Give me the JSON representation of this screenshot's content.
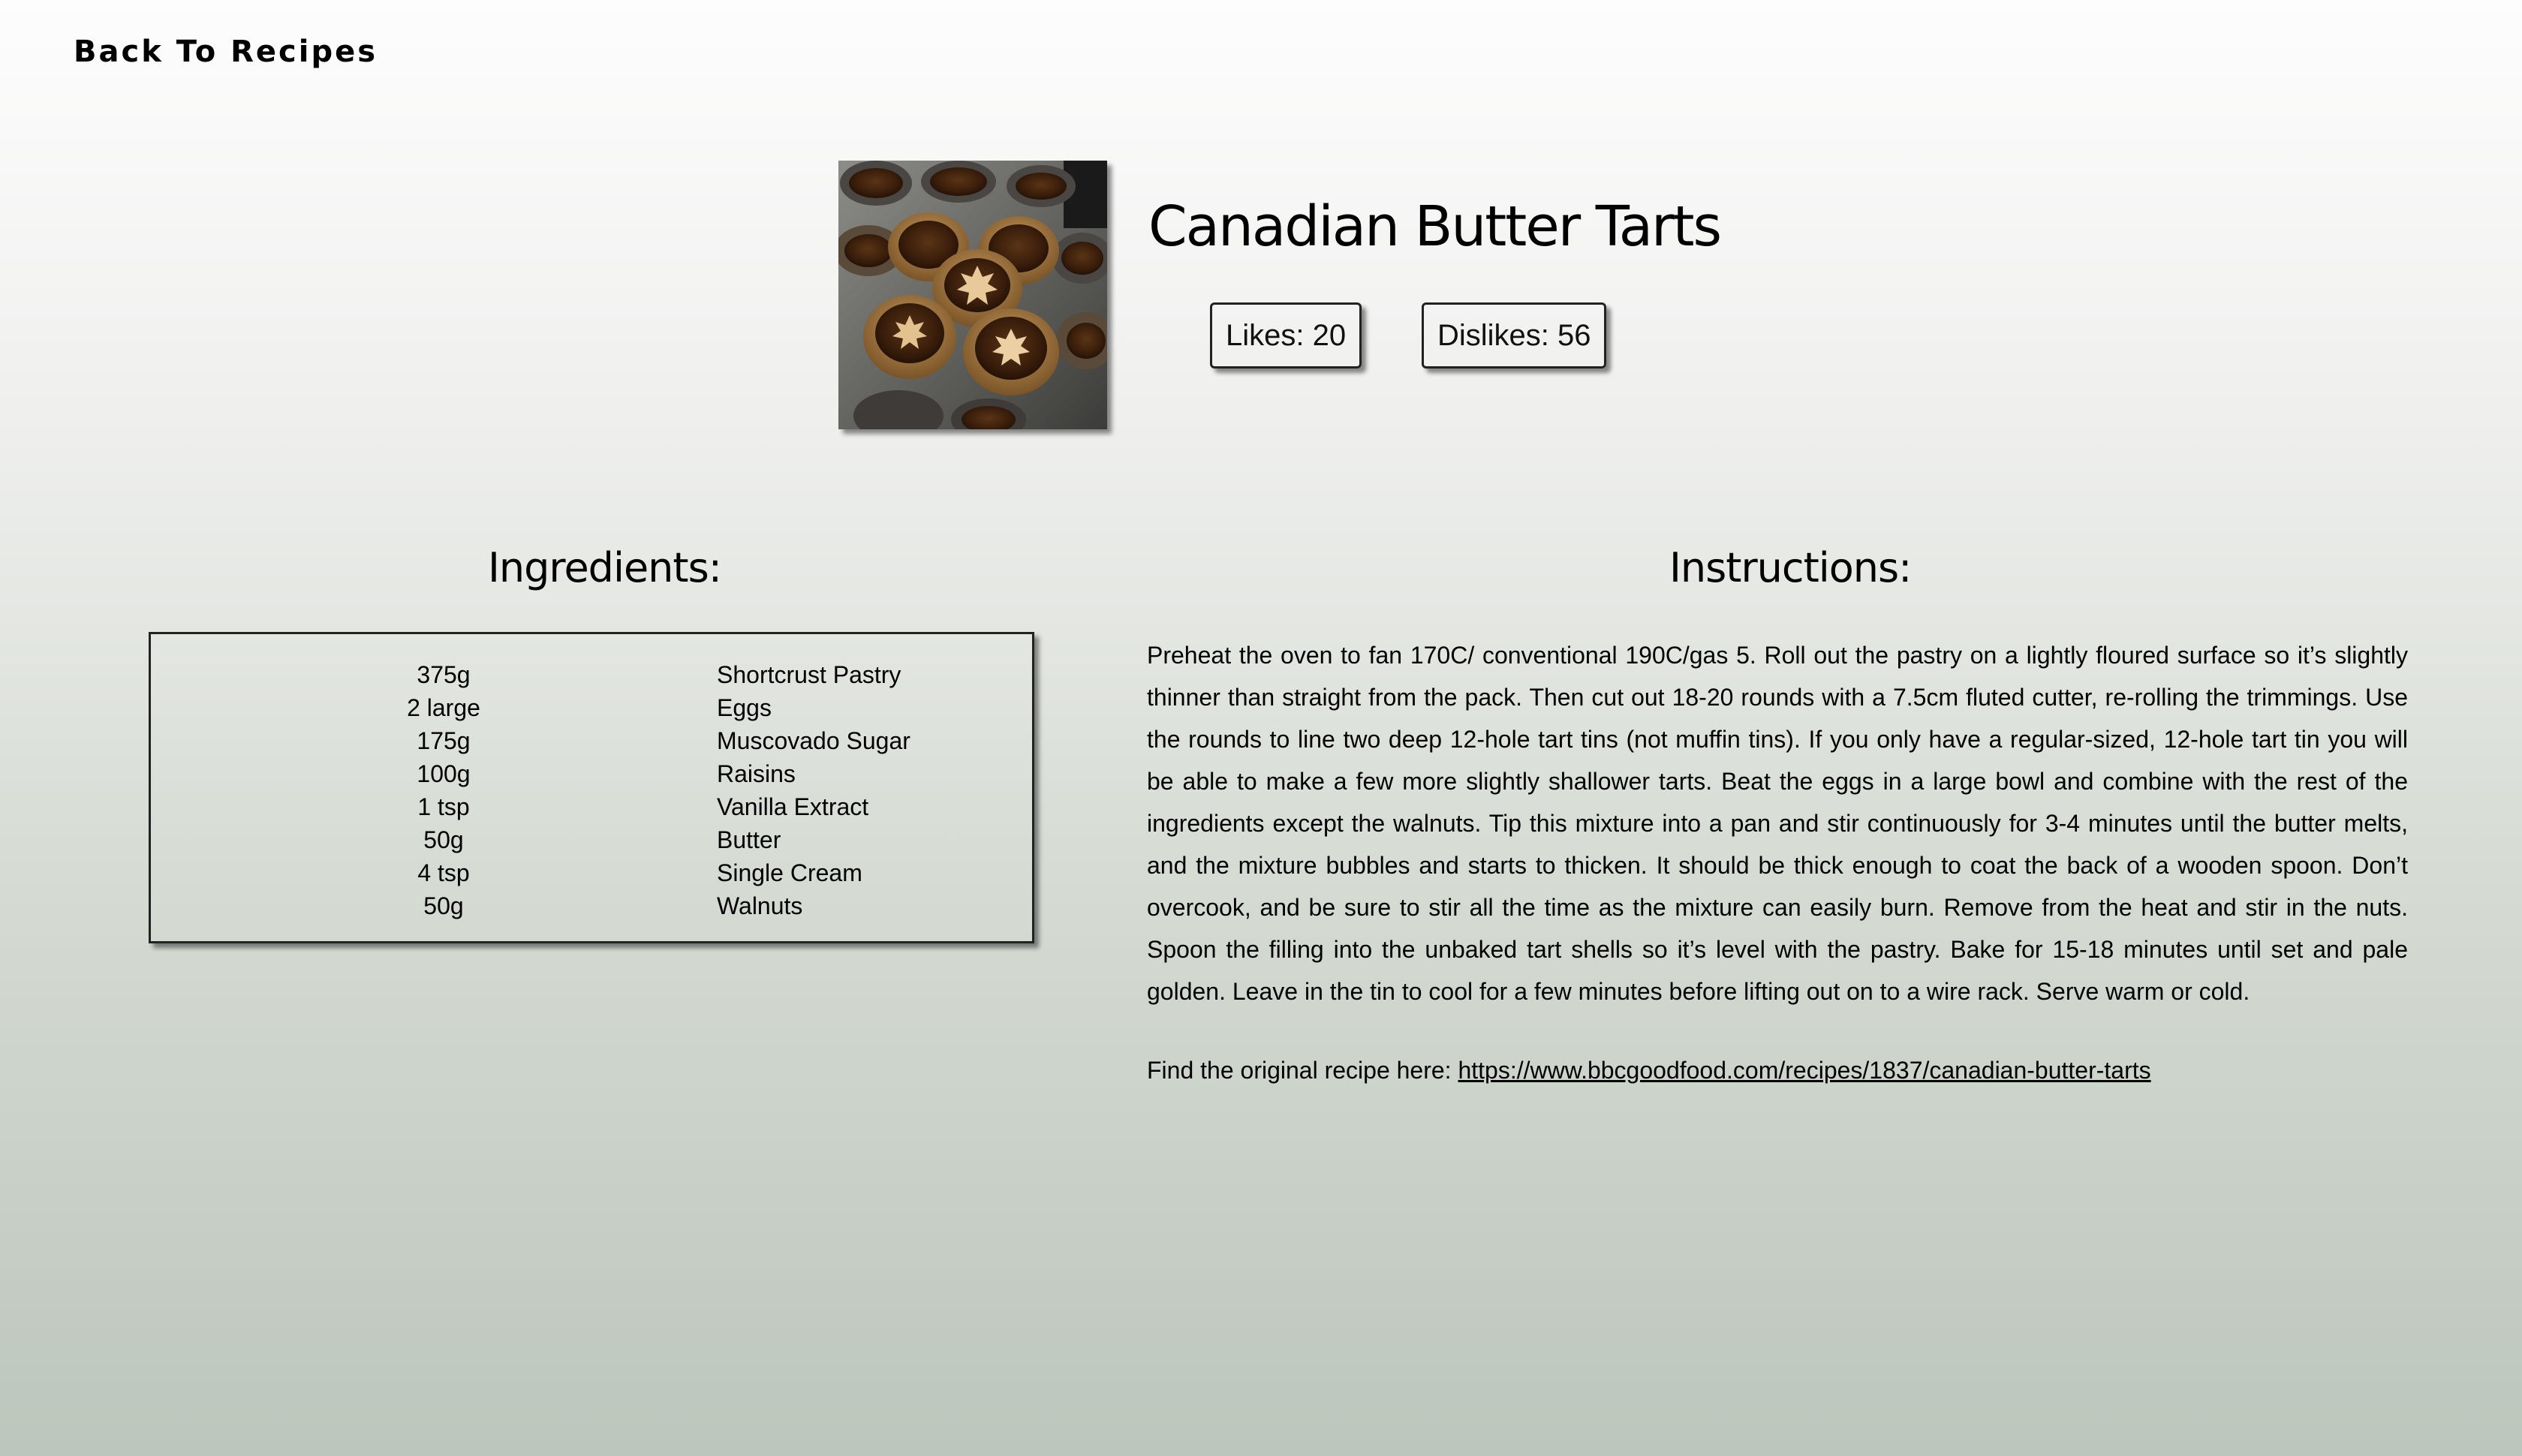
{
  "nav": {
    "back_label": "Back To Recipes"
  },
  "recipe": {
    "title": "Canadian Butter Tarts",
    "image_alt": "Butter tarts in a muffin tin",
    "likes_label": "Likes: 20",
    "dislikes_label": "Dislikes: 56",
    "likes": 20,
    "dislikes": 56
  },
  "ingredients": {
    "heading": "Ingredients:",
    "items": [
      {
        "quantity": "375g",
        "name": "Shortcrust Pastry"
      },
      {
        "quantity": "2 large",
        "name": "Eggs"
      },
      {
        "quantity": "175g",
        "name": "Muscovado Sugar"
      },
      {
        "quantity": "100g",
        "name": "Raisins"
      },
      {
        "quantity": "1 tsp",
        "name": "Vanilla Extract"
      },
      {
        "quantity": "50g",
        "name": "Butter"
      },
      {
        "quantity": "4 tsp",
        "name": "Single Cream"
      },
      {
        "quantity": "50g",
        "name": "Walnuts"
      }
    ]
  },
  "instructions": {
    "heading": "Instructions:",
    "text": "Preheat the oven to fan 170C/ conventional 190C/gas 5. Roll out the pastry on a lightly floured surface so it’s slightly thinner than straight from the pack. Then cut out 18-20 rounds with a 7.5cm fluted cutter, re-rolling the trimmings. Use the rounds to line two deep 12-hole tart tins (not muffin tins). If you only have a regular-sized, 12-hole tart tin you will be able to make a few more slightly shallower tarts. Beat the eggs in a large bowl and combine with the rest of the ingredients except the walnuts. Tip this mixture into a pan and stir continuously for 3-4 minutes until the butter melts, and the mixture bubbles and starts to thicken. It should be thick enough to coat the back of a wooden spoon. Don’t overcook, and be sure to stir all the time as the mixture can easily burn. Remove from the heat and stir in the nuts. Spoon the filling into the unbaked tart shells so it’s level with the pastry. Bake for 15-18 minutes until set and pale golden. Leave in the tin to cool for a few minutes before lifting out on to a wire rack. Serve warm or cold.",
    "source_prefix": "Find the original recipe here: ",
    "source_url": "https://www.bbcgoodfood.com/recipes/1837/canadian-butter-tarts"
  },
  "colors": {
    "background_top": "#fdfdfd",
    "background_bottom": "#bcc6bb",
    "text": "#000000"
  }
}
